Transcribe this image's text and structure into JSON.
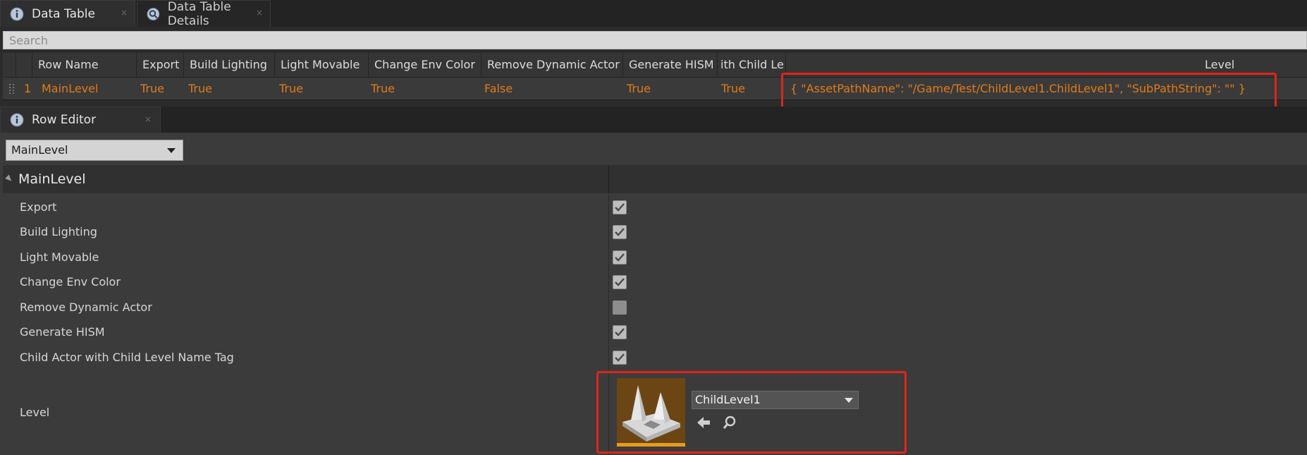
{
  "tabs_top": [
    {
      "label": "Data Table",
      "close": "×"
    },
    {
      "label": "Data Table Details",
      "close": "×"
    }
  ],
  "search": {
    "placeholder": "Search"
  },
  "table": {
    "columns": [
      "",
      "Row Name",
      "Export",
      "Build Lighting",
      "Light Movable",
      "Change Env Color",
      "Remove Dynamic Actor",
      "Generate HISM",
      "ith Child Le",
      "Level"
    ],
    "row": {
      "index": "1",
      "name": "MainLevel",
      "export": "True",
      "build_lighting": "True",
      "light_movable": "True",
      "change_env_color": "True",
      "remove_dynamic_actor": "False",
      "generate_hism": "True",
      "child_le": "True",
      "level": "{ \"AssetPathName\": \"/Game/Test/ChildLevel1.ChildLevel1\", \"SubPathString\": \"\" }"
    }
  },
  "row_editor": {
    "tab_label": "Row Editor",
    "tab_close": "×",
    "row_select": "MainLevel",
    "category": "MainLevel",
    "properties": [
      {
        "label": "Export",
        "checked": true
      },
      {
        "label": "Build Lighting",
        "checked": true
      },
      {
        "label": "Light Movable",
        "checked": true
      },
      {
        "label": "Change Env Color",
        "checked": true
      },
      {
        "label": "Remove Dynamic Actor",
        "checked": false
      },
      {
        "label": "Generate HISM",
        "checked": true
      },
      {
        "label": "Child Actor with Child Level Name Tag",
        "checked": true
      }
    ],
    "level_label": "Level",
    "level_asset": "ChildLevel1"
  },
  "colors": {
    "accent": "#e07b1a",
    "highlight": "#e2241b",
    "thumb_bar": "#e89b17"
  },
  "icons": [
    "info-icon",
    "details-icon",
    "close-icon",
    "grip-icon",
    "chevron-down-icon",
    "collapse-arrow-icon",
    "checkmark-icon",
    "level-thumbnail-icon",
    "use-selected-arrow-icon",
    "browse-magnifier-icon"
  ]
}
